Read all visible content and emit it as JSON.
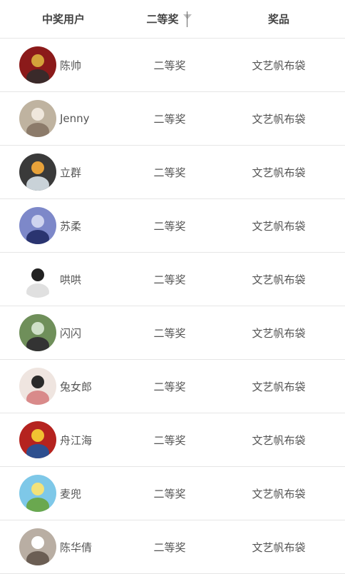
{
  "header": {
    "user_col": "中奖用户",
    "prize_level_col": "二等奖",
    "prize_col": "奖品"
  },
  "rows": [
    {
      "name": "陈帅",
      "level": "二等奖",
      "prize": "文艺帆布袋",
      "avatar": {
        "bg": "#8b1a1a",
        "fg": "#d4a33a",
        "accent": "#3a2a2a"
      }
    },
    {
      "name": "Jenny",
      "level": "二等奖",
      "prize": "文艺帆布袋",
      "avatar": {
        "bg": "#bfb3a0",
        "fg": "#efe7dc",
        "accent": "#8c7b6a"
      }
    },
    {
      "name": "立群",
      "level": "二等奖",
      "prize": "文艺帆布袋",
      "avatar": {
        "bg": "#3a3a3a",
        "fg": "#e8a23a",
        "accent": "#c9d2d8"
      }
    },
    {
      "name": "苏柔",
      "level": "二等奖",
      "prize": "文艺帆布袋",
      "avatar": {
        "bg": "#7d88c9",
        "fg": "#cfd4ef",
        "accent": "#2a3470"
      }
    },
    {
      "name": "哄哄",
      "level": "二等奖",
      "prize": "文艺帆布袋",
      "avatar": {
        "bg": "#ffffff",
        "fg": "#222222",
        "accent": "#e0e0e0"
      }
    },
    {
      "name": "闪闪",
      "level": "二等奖",
      "prize": "文艺帆布袋",
      "avatar": {
        "bg": "#6f8f5a",
        "fg": "#cfe0c8",
        "accent": "#333333"
      }
    },
    {
      "name": "兔女郎",
      "level": "二等奖",
      "prize": "文艺帆布袋",
      "avatar": {
        "bg": "#efe5e0",
        "fg": "#2a2a2a",
        "accent": "#d98a8a"
      }
    },
    {
      "name": "舟江海",
      "level": "二等奖",
      "prize": "文艺帆布袋",
      "avatar": {
        "bg": "#b5231f",
        "fg": "#f1c232",
        "accent": "#2e4f8f"
      }
    },
    {
      "name": "麦兜",
      "level": "二等奖",
      "prize": "文艺帆布袋",
      "avatar": {
        "bg": "#7ec8e8",
        "fg": "#f3e27a",
        "accent": "#6aa84f"
      }
    },
    {
      "name": "陈华倩",
      "level": "二等奖",
      "prize": "文艺帆布袋",
      "avatar": {
        "bg": "#b9aea3",
        "fg": "#ffffff",
        "accent": "#6b5e54"
      }
    }
  ],
  "icons": {
    "filter": "filter-icon"
  }
}
